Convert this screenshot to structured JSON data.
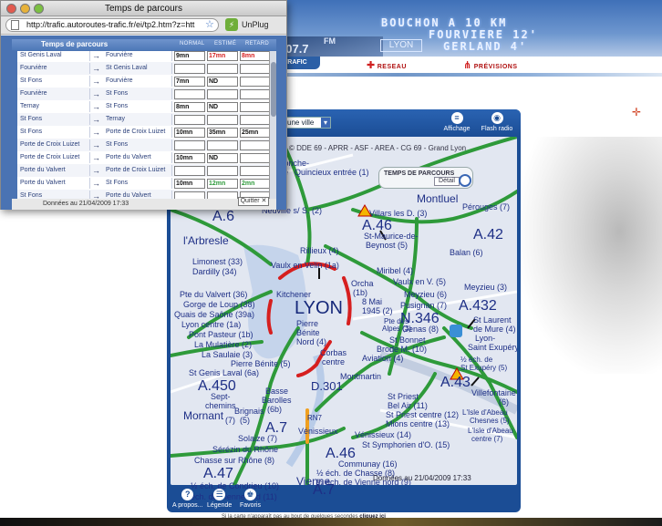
{
  "banner": {
    "line1": "BOUCHON A 10 KM",
    "line2": "FOURVIERE 12'",
    "line3": "GERLAND 4'",
    "sign": "LYON",
    "radio": "FM",
    "radio_num": "107.7",
    "nav": [
      "TRAFIC",
      "RESEAU",
      "PRÉVISIONS"
    ]
  },
  "map": {
    "select_value": "une ville",
    "buttons_top": [
      "Affichage",
      "Flash radio"
    ],
    "credits": "© DDE 69 - APRR - ASF - AREA - CG 69 - Grand Lyon",
    "tps_box_title": "TEMPS DE PARCOURS",
    "detail_label": "Détail",
    "date_text": "Données au  21/04/2009 17:33",
    "buttons_bottom": [
      "A propos...",
      "Légende",
      "Favoris"
    ],
    "note_text": "Si la carte n'apparaît pas au bout de quelques secondes",
    "note_link": "cliquez ici",
    "labels": {
      "roanne": "Quincieux entrée (1)",
      "sonche": "Ronche-",
      "sonche2": "ille",
      "a6": "A.6",
      "neuville": "Neuville s/ S. (2)",
      "villars": "Villars les D. (3)",
      "a46n": "A.46",
      "montluel": "Montluel",
      "perouges": "Pérouges (7)",
      "stmaurice": "St-Maurice-de-",
      "beynost": "Beynost (5)",
      "a42": "A.42",
      "balan": "Balan (6)",
      "arbresle": "l'Arbresle",
      "rillieux": "Rillieux (4)",
      "limonest": "Limonest (33)",
      "dardilly": "Dardilly (34)",
      "vaulx": "Vaulx en Velin (1a)",
      "miribel": "Miribel (4)",
      "vaulxv": "Vaulx en V. (5)",
      "meyzieu3": "Meyzieu (3)",
      "valvert": "Pte du Valvert (36)",
      "kitchener": "Kitchener",
      "orcha": "Orcha",
      "orcha2": "(1b)",
      "mai": "8 Mai",
      "mai2": "1945 (2)",
      "meyzieu6": "Meyzieu (6)",
      "gorge": "Gorge de Loup (38)",
      "lyon": "LYON",
      "pusignan": "Pusignan (7)",
      "a432": "A.432",
      "quais": "Quais de Saône (39a)",
      "lyoncentre": "Lyon centre (1a)",
      "ptealpes": "Pte des",
      "ptealpes2": "Alpes (3)",
      "n346": "N.346",
      "pontpasteur": "Pont Pasteur (1b)",
      "pierre": "Pierre",
      "pierre2": "Bénite",
      "pierre3": "Nord (4)",
      "genas": "Genas (8)",
      "stlaurent": "St Laurent",
      "stlaurent2": "de Mure (4)",
      "mulatiere": "La Mulatière (2)",
      "saulaie": "La Saulaie (3)",
      "stbonnet": "St Bonnet",
      "stbonnet2": "de M. (10)",
      "lyonstex": "Lyon-",
      "lyonstex2": "Saint Exupéry",
      "pbenite": "Pierre Bénite (5)",
      "bron": "Bron",
      "bron2": "Aviation (4)",
      "stgenis": "St Genis Laval (6a)",
      "corbas": "Corbas",
      "corbas2": "centre",
      "halfech": "½ éch. de",
      "halfech2": "St Exupéry (5)",
      "a450": "A.450",
      "d301": "D.301",
      "montmartin": "Montmartin",
      "a43": "A.43",
      "villefontaine": "Villefontaine",
      "villefontaine2": "(6)",
      "sept": "Sept-",
      "sept2": "chemins",
      "basse": "Basse",
      "basse2": "Barolles",
      "basse3": "(6b)",
      "stpriest": "St Priest",
      "stpriest2": "Bel Air (11)",
      "mornant": "Mornant",
      "brignais": "Brignais",
      "brignais2": "(5)",
      "n7": "(7)",
      "rn7": "RN7",
      "stpriestc": "St Priest centre (12)",
      "isle": "L'Isle d'Abeau",
      "isle2": "Chesnes (5)",
      "a7a": "A.7",
      "venissieux": "Vénissieux",
      "mions": "Mions centre (13)",
      "isle3": "L'Isle d'Abeau",
      "isle4": "centre (7)",
      "solaize": "Solaize (7)",
      "venissieux14": "Vénissieux (14)",
      "serezin": "Sérézin du Rhône",
      "stsymph": "St Symphorien d'O. (15)",
      "a46s": "A.46",
      "chasse": "Chasse sur Rhône (8)",
      "communay": "Communay (16)",
      "a47": "A.47",
      "halfchasse": "½ éch. de Chasse (8)",
      "halfvienne": "½ éch. de Vienne nord (9)",
      "condrieu": "½ éch. de Condrieu (10)",
      "viennesud": "½ éch. de Vienne sud (11)",
      "vienne": "Vienne",
      "a7b": "A.7",
      "d75": "D. 75",
      "d77": "D. 517"
    }
  },
  "popup": {
    "window_title": "Temps de parcours",
    "url": "http://trafic.autoroutes-trafic.fr/ei/tp2.htm?z=htt",
    "unplug": "UnPlug",
    "table_title": "Temps de parcours",
    "col_normal": "NORMAL",
    "col_estime": "ESTIMÉ",
    "col_retard": "RETARD",
    "arrow": "→",
    "rows": [
      {
        "from": "St Genis Laval",
        "to": "Fourvière",
        "normal": "9mn",
        "estime": "17mn",
        "retard": "8mn",
        "red": true
      },
      {
        "from": "Fourvière",
        "to": "St Genis Laval",
        "normal": "",
        "estime": "",
        "retard": "",
        "red": false
      },
      {
        "from": "St Fons",
        "to": "Fourvière",
        "normal": "7mn",
        "estime": "ND",
        "retard": "",
        "red": false
      },
      {
        "from": "Fourvière",
        "to": "St Fons",
        "normal": "",
        "estime": "",
        "retard": "",
        "red": false
      },
      {
        "from": "Ternay",
        "to": "St Fons",
        "normal": "8mn",
        "estime": "ND",
        "retard": "",
        "red": false
      },
      {
        "from": "St Fons",
        "to": "Ternay",
        "normal": "",
        "estime": "",
        "retard": "",
        "red": false
      },
      {
        "from": "St Fons",
        "to": "Porte de Croix Luizet",
        "normal": "10mn",
        "estime": "35mn",
        "retard": "25mn",
        "red": false
      },
      {
        "from": "Porte de Croix Luizet",
        "to": "St Fons",
        "normal": "",
        "estime": "",
        "retard": "",
        "red": false
      },
      {
        "from": "Porte de Croix Luizet",
        "to": "Porte du Valvert",
        "normal": "10mn",
        "estime": "ND",
        "retard": "",
        "red": false
      },
      {
        "from": "Porte du Valvert",
        "to": "Porte de Croix Luizet",
        "normal": "",
        "estime": "",
        "retard": "",
        "red": false
      },
      {
        "from": "Porte du Valvert",
        "to": "St Fons",
        "normal": "10mn",
        "estime": "12mn",
        "retard": "2mn",
        "green": true
      },
      {
        "from": "St Fons",
        "to": "Porte du Valvert",
        "normal": "",
        "estime": "",
        "retard": "",
        "red": false
      }
    ],
    "footer_date": "Données au 21/04/2009 17:33",
    "quit_label": "Quitter ✕"
  },
  "colors": {
    "accent_blue": "#1b4d95",
    "road_green": "#2e9a3a",
    "congestion_red": "#d61f1f",
    "slow_orange": "#f0a020"
  }
}
